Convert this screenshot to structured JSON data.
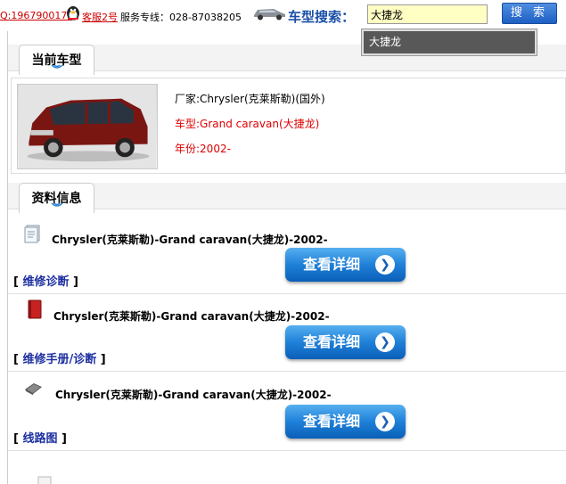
{
  "header": {
    "qq1": "Q:1967900174",
    "qq2": "客服2号",
    "hotline": "服务专线：028-87038205",
    "search_label": "车型搜索：",
    "search_value": "大捷龙",
    "search_button": "搜 索",
    "suggestion": "大捷龙"
  },
  "current": {
    "heading": "当前车型",
    "maker": "厂家:Chrysler(克莱斯勒)(国外)",
    "model": "车型:Grand caravan(大捷龙)",
    "year": "年份:2002-"
  },
  "docs": {
    "heading": "资料信息",
    "items": [
      {
        "title": "Chrysler(克莱斯勒)-Grand caravan(大捷龙)-2002-",
        "category": "维修诊断",
        "button": "查看详细",
        "icon": "document-icon"
      },
      {
        "title": "Chrysler(克莱斯勒)-Grand caravan(大捷龙)-2002-",
        "category": "维修手册/诊断",
        "button": "查看详细",
        "icon": "book-icon"
      },
      {
        "title": "Chrysler(克莱斯勒)-Grand caravan(大捷龙)-2002-",
        "category": "线路图",
        "button": "查看详细",
        "icon": "wiring-icon"
      }
    ]
  }
}
